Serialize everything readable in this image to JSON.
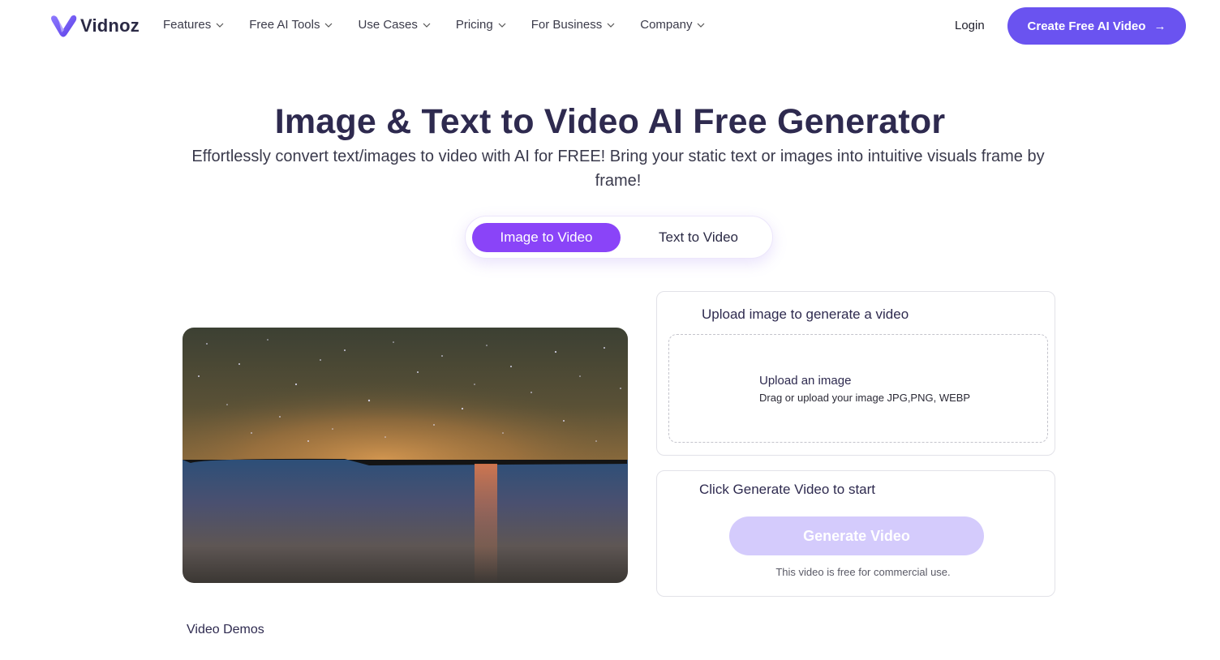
{
  "brand": {
    "name": "Vidnoz",
    "logo_icon": "vidnoz-v-logo-icon",
    "accent": "#6a53f0",
    "tab_active_color": "#8a44f8",
    "disabled_button_color": "#d4cbfc"
  },
  "nav": {
    "items": [
      {
        "label": "Features",
        "icon": "chevron-down-icon"
      },
      {
        "label": "Free AI Tools",
        "icon": "chevron-down-icon"
      },
      {
        "label": "Use Cases",
        "icon": "chevron-down-icon"
      },
      {
        "label": "Pricing",
        "icon": "chevron-down-icon"
      },
      {
        "label": "For Business",
        "icon": "chevron-down-icon"
      },
      {
        "label": "Company",
        "icon": "chevron-down-icon"
      }
    ],
    "login_label": "Login",
    "cta_label": "Create Free AI Video",
    "cta_icon": "arrow-right-icon",
    "cta_arrow": "→"
  },
  "hero": {
    "title": "Image & Text to Video AI Free Generator",
    "subtitle": "Effortlessly convert text/images to video with AI for FREE! Bring your static text or images into intuitive visuals frame by frame!"
  },
  "tabs": [
    {
      "label": "Image to Video",
      "active": true
    },
    {
      "label": "Text to Video",
      "active": false
    }
  ],
  "preview": {
    "alt": "Starry night sky over a calm lake with orange glow on the horizon"
  },
  "upload_card": {
    "title": "Upload image to generate a video",
    "dropzone_title": "Upload an image",
    "dropzone_hint": "Drag or upload your image JPG,PNG, WEBP"
  },
  "generate_card": {
    "title": "Click Generate Video to start",
    "button_label": "Generate Video",
    "note": "This video is free for commercial use."
  },
  "demos_heading": "Video Demos"
}
